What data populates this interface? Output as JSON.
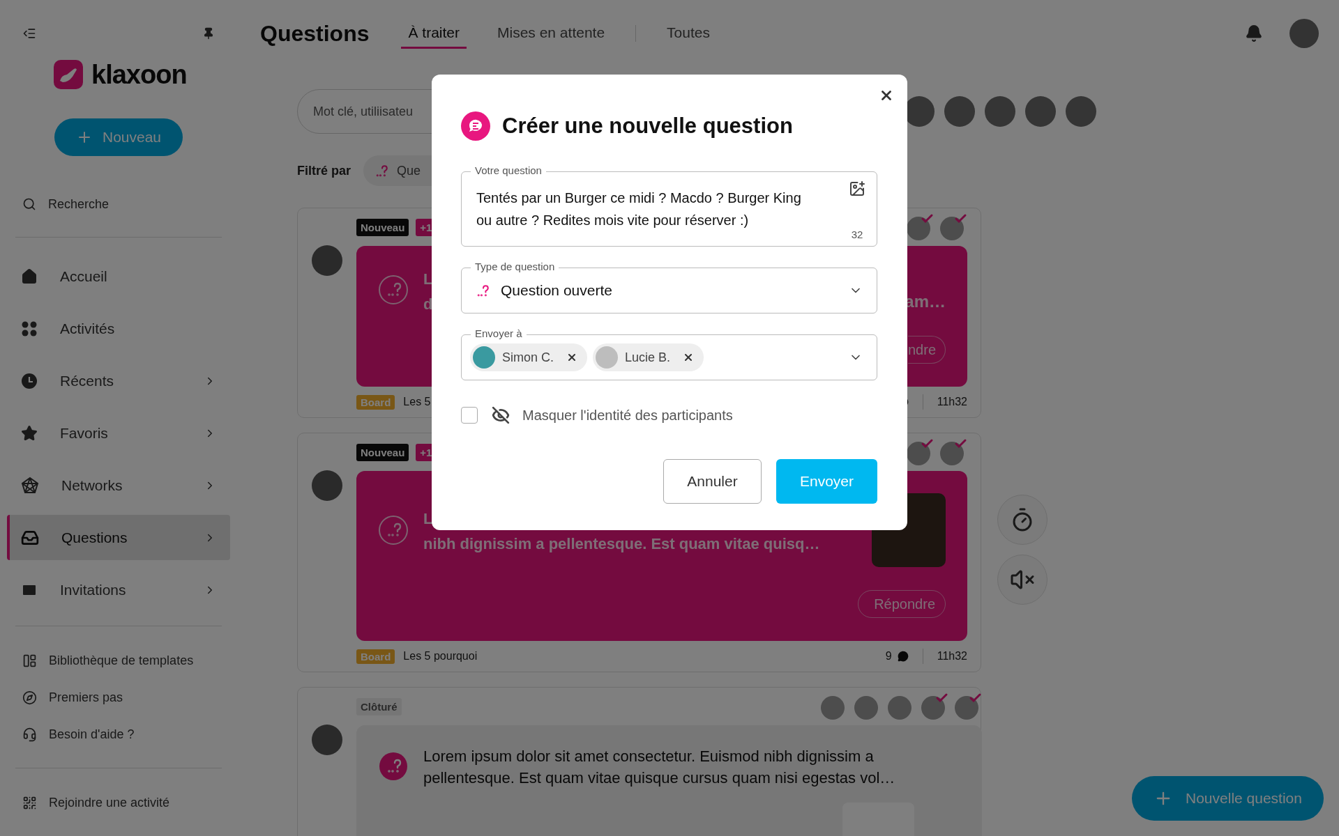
{
  "sidebar": {
    "logo_text": "klaxoon",
    "new_button": "Nouveau",
    "search_label": "Recherche",
    "nav": [
      {
        "label": "Accueil",
        "selected": false,
        "has_submenu": false
      },
      {
        "label": "Activités",
        "selected": false,
        "has_submenu": false
      },
      {
        "label": "Récents",
        "selected": false,
        "has_submenu": true
      },
      {
        "label": "Favoris",
        "selected": false,
        "has_submenu": true
      },
      {
        "label": "Networks",
        "selected": false,
        "has_submenu": true
      },
      {
        "label": "Questions",
        "selected": true,
        "has_submenu": true
      },
      {
        "label": "Invitations",
        "selected": false,
        "has_submenu": true
      }
    ],
    "links": [
      "Bibliothèque de templates",
      "Premiers pas",
      "Besoin d'aide ?"
    ],
    "join": "Rejoindre une activité"
  },
  "header": {
    "title": "Questions",
    "tabs": [
      {
        "label": "À traiter",
        "selected": true
      },
      {
        "label": "Mises en attente",
        "selected": false
      },
      {
        "label": "Toutes",
        "selected": false
      }
    ]
  },
  "search": {
    "placeholder": "Mot clé, utiliisateu"
  },
  "participants": [
    {
      "kind": "photo"
    },
    {
      "kind": "photo"
    },
    {
      "kind": "photo"
    },
    {
      "kind": "photo"
    },
    {
      "kind": "photo"
    }
  ],
  "filter": {
    "label": "Filtré par",
    "chip": "Que"
  },
  "cards": [
    {
      "kind": "open",
      "status": [
        {
          "label": "Nouveau",
          "kind": "new"
        },
        {
          "label": "+1",
          "kind": "count"
        }
      ],
      "responders": [
        {
          "answered": true
        },
        {
          "answered": true
        }
      ],
      "text_lines": [
        "L",
        "d"
      ],
      "right_text": "am…",
      "thumbnail": false,
      "answer_button": "ndre",
      "board_tag": "Board",
      "board_name": "Les 5",
      "time": "11h32"
    },
    {
      "kind": "open",
      "status": [
        {
          "label": "Nouveau",
          "kind": "new"
        },
        {
          "label": "+1",
          "kind": "count"
        }
      ],
      "responders": [
        {
          "answered": true
        },
        {
          "answered": true
        }
      ],
      "text_lines": [
        "L",
        "nibh dignissim a pellentesque. Est quam vitae quisq…"
      ],
      "thumbnail": true,
      "answer_button": "Répondre",
      "board_tag": "Board",
      "board_name": "Les 5 pourquoi",
      "comments": "9",
      "time": "11h32"
    },
    {
      "kind": "closed",
      "status": [
        {
          "label": "Clôturé",
          "kind": "closed"
        }
      ],
      "responders": [
        {
          "answered": false
        },
        {
          "answered": false
        },
        {
          "answered": false
        },
        {
          "answered": true
        },
        {
          "answered": true
        }
      ],
      "text": "Lorem ipsum dolor sit amet consectetur. Euismod nibh dignissim a pellentesque. Est quam vitae quisque cursus quam nisi egestas vol…",
      "attachment": true
    }
  ],
  "fab": "Nouvelle question",
  "modal": {
    "title": "Créer une nouvelle question",
    "question": {
      "label": "Votre question",
      "value": "Tentés par un Burger ce midi ? Macdo ? Burger King ou autre ? Redites mois vite pour réserver :)",
      "counter": "32"
    },
    "type": {
      "label": "Type de question",
      "value": "Question ouverte"
    },
    "recipients": {
      "label": "Envoyer à",
      "chips": [
        "Simon C.",
        "Lucie B."
      ]
    },
    "anonymous": {
      "label": "Masquer l'identité des participants",
      "checked": false
    },
    "cancel": "Annuler",
    "submit": "Envoyer"
  }
}
